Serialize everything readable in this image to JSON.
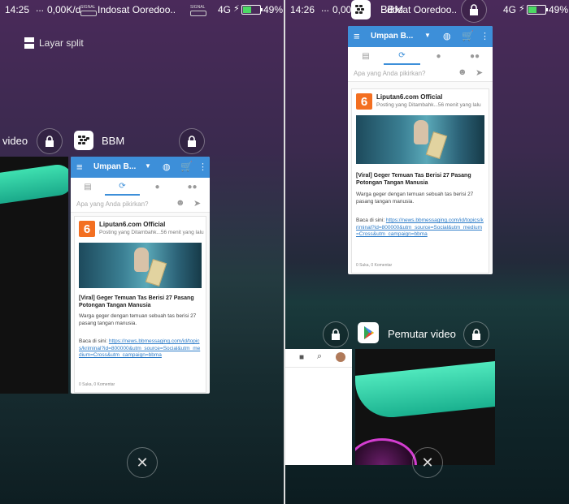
{
  "left": {
    "status": {
      "time": "14:25",
      "dots": "...",
      "speed": "0,00K/d",
      "signal_label": "SIGNAL",
      "carrier": "Indosat Ooredoo..",
      "network": "4G",
      "battery": "49%"
    },
    "split_label": "Layar split",
    "prev_app_label": "video",
    "app_label": "BBM",
    "bbm": {
      "title": "Umpan B...",
      "compose_placeholder": "Apa yang Anda pikirkan?",
      "post": {
        "logo": "6",
        "name": "Liputan6.com Official",
        "meta": "Posting yang Ditambahk...56 menit yang lalu",
        "title": "[Viral] Geger Temuan Tas Berisi 27 Pasang Potongan Tangan Manusia",
        "body": "Warga geger dengan temuan sebuah tas berisi 27 pasang tangan manusia.",
        "read_prefix": "Baca di sini: ",
        "link": "https://news.bbmessaging.com/id/topics/kriminal?id=800000&utm_source=Social&utm_medium=Cross&utm_campaign=bbma",
        "footer": "0 Suka, 0 Komentar"
      }
    }
  },
  "right": {
    "status": {
      "time": "14:26",
      "dots": "...",
      "speed": "0,00K",
      "carrier": "dosat Ooredoo..",
      "network": "4G",
      "battery": "49%"
    },
    "top_app_label": "BBM",
    "app_label": "Pemutar video",
    "bbm": {
      "title": "Umpan B...",
      "compose_placeholder": "Apa yang Anda pikirkan?",
      "post": {
        "logo": "6",
        "name": "Liputan6.com Official",
        "meta": "Posting yang Ditambahk...56 menit yang lalu",
        "title": "[Viral] Geger Temuan Tas Berisi 27 Pasang Potongan Tangan Manusia",
        "body": "Warga geger dengan temuan sebuah tas berisi 27 pasang tangan manusia.",
        "read_prefix": "Baca di sini: ",
        "link": "https://news.bbmessaging.com/id/topics/kriminal?id=800000&utm_source=Social&utm_medium=Cross&utm_campaign=bbma",
        "footer": "0 Suka, 0 Komentar"
      }
    }
  },
  "colors": {
    "bbm_blue": "#3d8fd9",
    "battery_green": "#4cd964",
    "liputan_orange": "#f36f21",
    "link_blue": "#2b7bc8"
  },
  "icons": [
    "split-screen-icon",
    "lock-icon",
    "bbm-icon",
    "menu-icon",
    "dropdown-icon",
    "globe-icon",
    "cart-icon",
    "more-icon",
    "chat-icon",
    "refresh-icon",
    "person-icon",
    "group-icon",
    "emoji-icon",
    "send-icon",
    "play-store-icon",
    "video-camera-icon",
    "search-icon",
    "avatar-icon",
    "close-icon"
  ]
}
